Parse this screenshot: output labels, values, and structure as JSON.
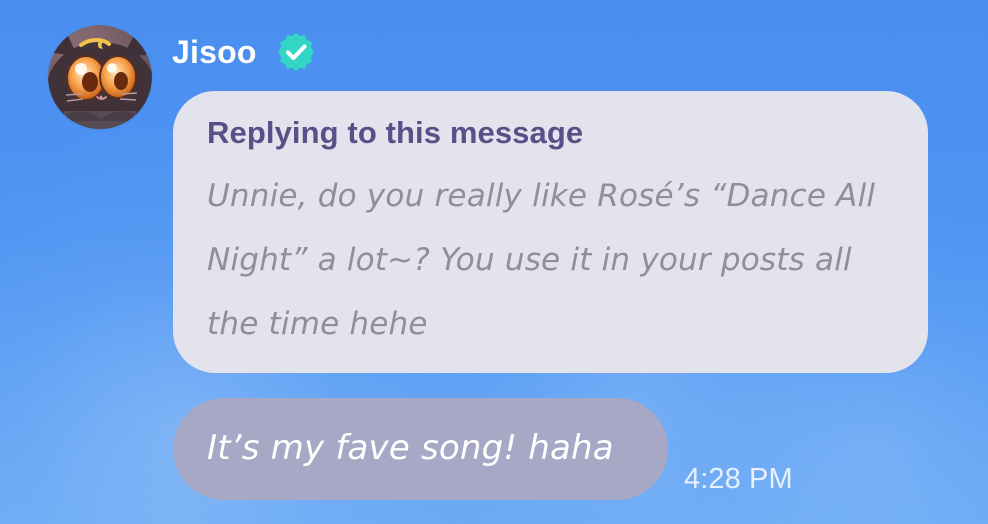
{
  "message": {
    "sender": {
      "name": "Jisoo",
      "avatar_icon": "cat-avatar-icon",
      "verified_icon": "verified-badge-icon"
    },
    "reply": {
      "heading": "Replying to this message",
      "text": "Unnie, do you really like Rosé’s “Dance All Night” a lot~? You use it in your posts all the time hehe"
    },
    "text": "It’s my fave song! haha",
    "time": "4:28 PM"
  },
  "colors": {
    "background": "#4f95f3",
    "reply_card": "#e3e3ee",
    "reply_heading": "#5a4f87",
    "reply_text": "#8f8f98",
    "message_bubble": "#a7a7c6",
    "verified_badge": "#33d6c4",
    "timestamp": "#e6f0ff"
  }
}
